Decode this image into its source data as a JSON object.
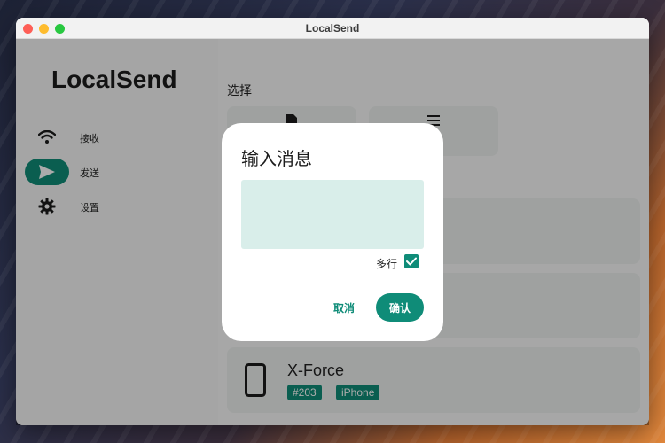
{
  "window": {
    "title": "LocalSend"
  },
  "sidebar": {
    "app_name": "LocalSend",
    "items": [
      {
        "label": "接收",
        "icon": "wifi-icon"
      },
      {
        "label": "发送",
        "icon": "send-icon",
        "active": true
      },
      {
        "label": "设置",
        "icon": "gear-icon"
      }
    ]
  },
  "main": {
    "selection_title": "选择",
    "selection_options": [
      {
        "icon": "file-icon"
      },
      {
        "icon": "text-icon"
      }
    ],
    "devices": [
      {
        "name": "X-Force",
        "tags": [
          "#203",
          "iPhone"
        ],
        "icon": "phone-icon"
      }
    ]
  },
  "dialog": {
    "title": "输入消息",
    "message_value": "",
    "multiline_label": "多行",
    "multiline_checked": true,
    "cancel_label": "取消",
    "confirm_label": "确认"
  },
  "colors": {
    "accent": "#0f8c78",
    "input_bg": "#d9eeea"
  }
}
